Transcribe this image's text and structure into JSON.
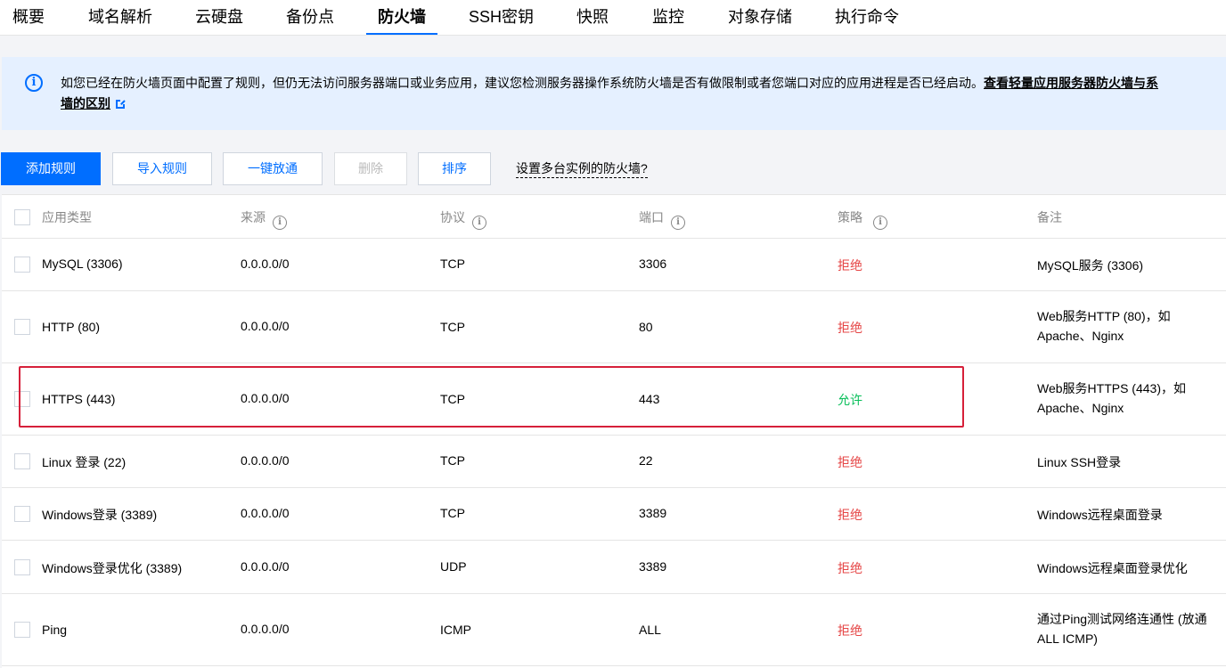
{
  "tabs": [
    {
      "label": "概要"
    },
    {
      "label": "域名解析"
    },
    {
      "label": "云硬盘"
    },
    {
      "label": "备份点"
    },
    {
      "label": "防火墙",
      "active": true
    },
    {
      "label": "SSH密钥"
    },
    {
      "label": "快照"
    },
    {
      "label": "监控"
    },
    {
      "label": "对象存储"
    },
    {
      "label": "执行命令"
    }
  ],
  "banner": {
    "text": "如您已经在防火墙页面中配置了规则，但仍无法访问服务器端口或业务应用，建议您检测服务器操作系统防火墙是否有做限制或者您端口对应的应用进程是否已经启动。",
    "link_part1": "查看轻量应用服务器防火墙与系",
    "link_part2": "墙的区别",
    "info_icon": "info-icon",
    "external_icon": "external-link-icon"
  },
  "toolbar": {
    "add_rule": "添加规则",
    "import_rule": "导入规则",
    "one_click": "一键放通",
    "delete": "删除",
    "sort": "排序",
    "multi_instance": "设置多台实例的防火墙?"
  },
  "table": {
    "headers": {
      "app_type": "应用类型",
      "source": "来源",
      "protocol": "协议",
      "port": "端口",
      "policy": "策略",
      "note": "备注"
    },
    "rows": [
      {
        "app": "MySQL (3306)",
        "source": "0.0.0.0/0",
        "protocol": "TCP",
        "port": "3306",
        "policy": "拒绝",
        "note": "MySQL服务 (3306)"
      },
      {
        "app": "HTTP (80)",
        "source": "0.0.0.0/0",
        "protocol": "TCP",
        "port": "80",
        "policy": "拒绝",
        "note": "Web服务HTTP (80)，如Apache、Nginx"
      },
      {
        "app": "HTTPS (443)",
        "source": "0.0.0.0/0",
        "protocol": "TCP",
        "port": "443",
        "policy": "允许",
        "note": "Web服务HTTPS (443)，如Apache、Nginx"
      },
      {
        "app": "Linux 登录 (22)",
        "source": "0.0.0.0/0",
        "protocol": "TCP",
        "port": "22",
        "policy": "拒绝",
        "note": "Linux SSH登录"
      },
      {
        "app": "Windows登录 (3389)",
        "source": "0.0.0.0/0",
        "protocol": "TCP",
        "port": "3389",
        "policy": "拒绝",
        "note": "Windows远程桌面登录"
      },
      {
        "app": "Windows登录优化 (3389)",
        "source": "0.0.0.0/0",
        "protocol": "UDP",
        "port": "3389",
        "policy": "拒绝",
        "note": "Windows远程桌面登录优化"
      },
      {
        "app": "Ping",
        "source": "0.0.0.0/0",
        "protocol": "ICMP",
        "port": "ALL",
        "policy": "拒绝",
        "note": "通过Ping测试网络连通性 (放通ALL ICMP)"
      }
    ]
  },
  "colors": {
    "accent": "#006eff",
    "deny": "#e54545",
    "allow": "#0abf5b",
    "highlight": "#d6203a"
  }
}
